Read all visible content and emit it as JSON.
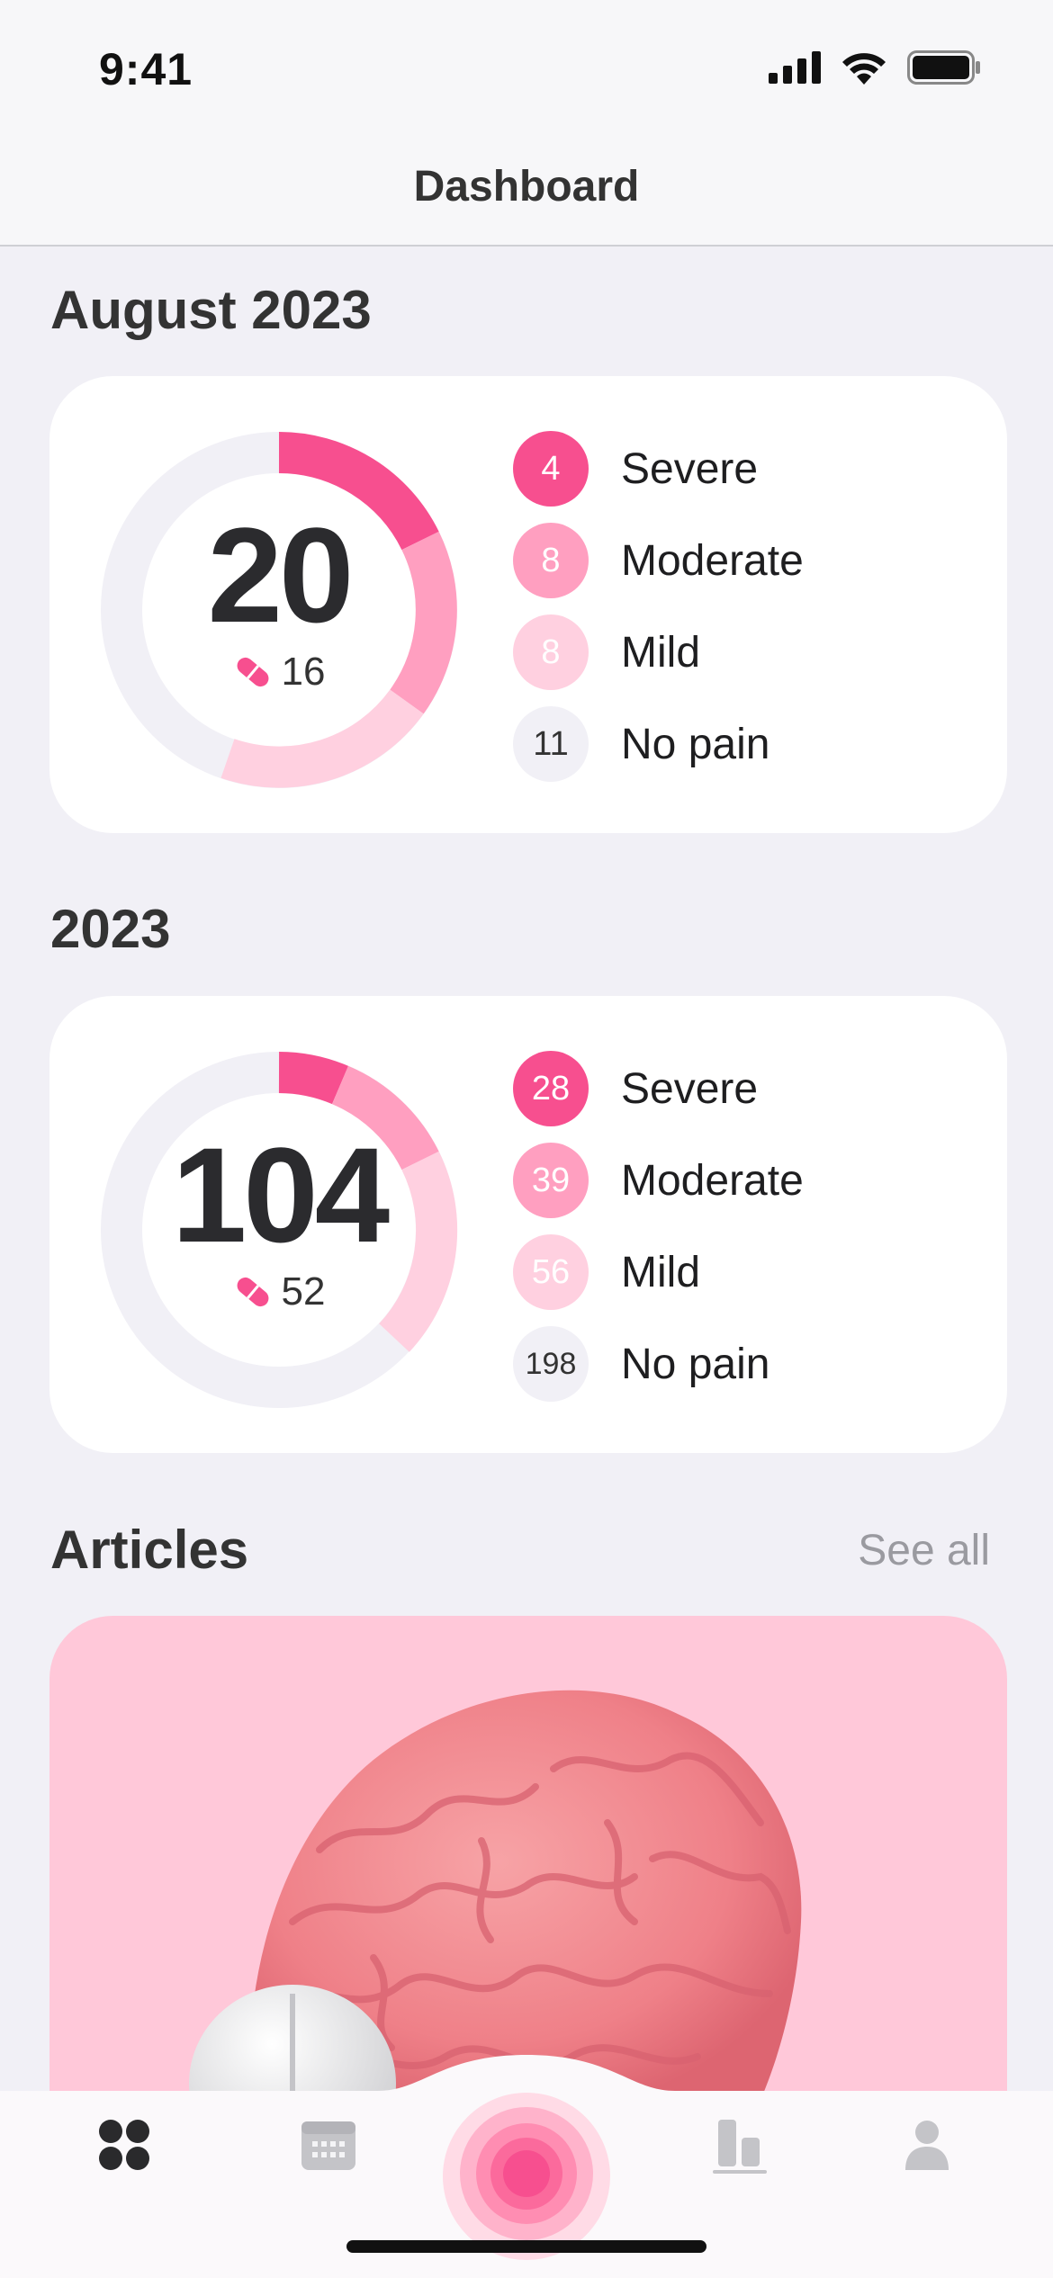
{
  "status_bar": {
    "time": "9:41"
  },
  "nav": {
    "title": "Dashboard"
  },
  "colors": {
    "severe": "#f74f8f",
    "moderate": "#ff9fc0",
    "mild": "#ffd0e0",
    "no_pain": "#f1f0f6",
    "background": "#f1f0f6",
    "article_bg": "#ffc8d9"
  },
  "month_section": {
    "title": "August 2023",
    "total": "20",
    "pills": "16",
    "legend": [
      {
        "value": "4",
        "label": "Severe",
        "key": "severe"
      },
      {
        "value": "8",
        "label": "Moderate",
        "key": "moderate"
      },
      {
        "value": "8",
        "label": "Mild",
        "key": "mild"
      },
      {
        "value": "11",
        "label": "No pain",
        "key": "no_pain"
      }
    ]
  },
  "year_section": {
    "title": "2023",
    "total": "104",
    "pills": "52",
    "legend": [
      {
        "value": "28",
        "label": "Severe",
        "key": "severe"
      },
      {
        "value": "39",
        "label": "Moderate",
        "key": "moderate"
      },
      {
        "value": "56",
        "label": "Mild",
        "key": "mild"
      },
      {
        "value": "198",
        "label": "No pain",
        "key": "no_pain"
      }
    ]
  },
  "articles": {
    "title": "Articles",
    "see_all": "See all"
  },
  "tab_bar": {
    "items": [
      {
        "icon": "dashboard-grid-icon"
      },
      {
        "icon": "calendar-icon"
      },
      {
        "icon": "record-pain-icon"
      },
      {
        "icon": "stats-bar-icon"
      },
      {
        "icon": "profile-icon"
      }
    ]
  }
}
